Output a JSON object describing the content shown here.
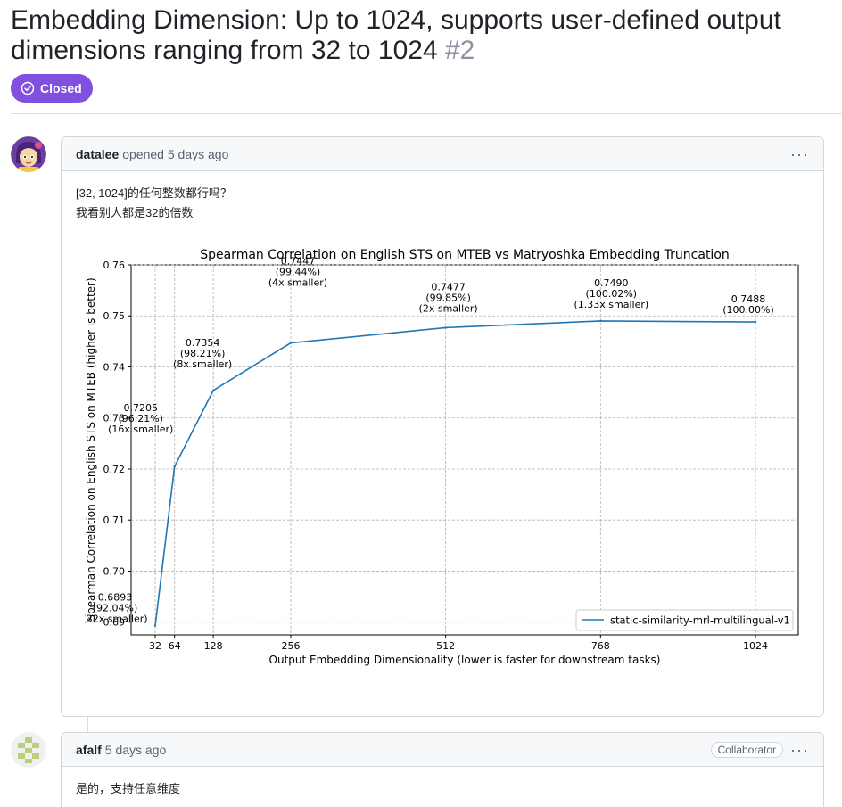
{
  "issue": {
    "title": "Embedding Dimension: Up to 1024, supports user-defined output dimensions ranging from 32 to 1024",
    "number": "#2",
    "state": "Closed",
    "state_color": "#8250df"
  },
  "comments": [
    {
      "author": "datalee",
      "action": "opened 5 days ago",
      "avatar_icon": "user-avatar-icon",
      "body_lines": [
        "[32, 1024]的任何整数都行吗？",
        "我看别人都是32的倍数"
      ],
      "menu_icon": "kebab-horizontal-icon"
    },
    {
      "author": "afalf",
      "action": "5 days ago",
      "role_badge": "Collaborator",
      "avatar_icon": "identicon-avatar-icon",
      "body_lines": [
        "是的，支持任意维度"
      ],
      "menu_icon": "kebab-horizontal-icon"
    }
  ],
  "chart_data": {
    "type": "line",
    "title": "Spearman Correlation on English STS on MTEB vs Matryoshka Embedding Truncation",
    "xlabel": "Output Embedding Dimensionality (lower is faster for downstream tasks)",
    "ylabel": "Spearman Correlation on English STS on MTEB (higher is better)",
    "x": [
      32,
      64,
      128,
      256,
      512,
      768,
      1024
    ],
    "x_tick_labels": [
      "32",
      "64",
      "128",
      "256",
      "512",
      "768",
      "1024"
    ],
    "y_ticks": [
      "0.69",
      "0.70",
      "0.71",
      "0.72",
      "0.73",
      "0.74",
      "0.75",
      "0.76"
    ],
    "ylim": [
      0.6875,
      0.76
    ],
    "grid": true,
    "legend_position": "lower right",
    "series": [
      {
        "name": "static-similarity-mrl-multilingual-v1",
        "color": "#1f77b4",
        "values": [
          0.6893,
          0.7205,
          0.7354,
          0.7447,
          0.7477,
          0.749,
          0.7488
        ]
      }
    ],
    "annotations": [
      [
        "0.6893",
        "(92.04%)",
        "(32x smaller)"
      ],
      [
        "0.7205",
        "(96.21%)",
        "(16x smaller)"
      ],
      [
        "0.7354",
        "(98.21%)",
        "(8x smaller)"
      ],
      [
        "0.7447",
        "(99.44%)",
        "(4x smaller)"
      ],
      [
        "0.7477",
        "(99.85%)",
        "(2x smaller)"
      ],
      [
        "0.7490",
        "(100.02%)",
        "(1.33x smaller)"
      ],
      [
        "0.7488",
        "(100.00%)"
      ]
    ]
  }
}
